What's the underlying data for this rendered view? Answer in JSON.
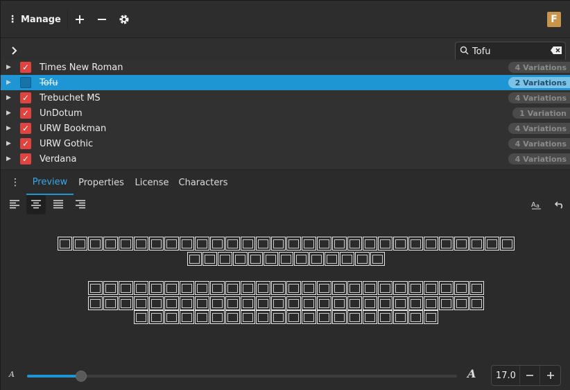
{
  "header": {
    "manage_label": "Manage",
    "font_badge": "F"
  },
  "search": {
    "value": "Tofu"
  },
  "fonts": [
    {
      "name": "Times New Roman",
      "variations": "4 Variations",
      "checked": true,
      "selected": false
    },
    {
      "name": "Tofu",
      "variations": "2 Variations",
      "checked": false,
      "selected": true
    },
    {
      "name": "Trebuchet MS",
      "variations": "4 Variations",
      "checked": true,
      "selected": false
    },
    {
      "name": "UnDotum",
      "variations": "1 Variation",
      "checked": true,
      "selected": false
    },
    {
      "name": "URW Bookman",
      "variations": "4 Variations",
      "checked": true,
      "selected": false
    },
    {
      "name": "URW Gothic",
      "variations": "4 Variations",
      "checked": true,
      "selected": false
    },
    {
      "name": "Verdana",
      "variations": "4 Variations",
      "checked": true,
      "selected": false
    }
  ],
  "tabs": [
    {
      "label": "Preview",
      "active": true
    },
    {
      "label": "Properties",
      "active": false
    },
    {
      "label": "License",
      "active": false
    },
    {
      "label": "Characters",
      "active": false
    }
  ],
  "preview": {
    "line_glyph_counts": [
      30,
      13,
      0,
      26,
      26,
      20
    ]
  },
  "size": {
    "value": "17.0",
    "slider_fraction": 0.125
  },
  "colors": {
    "accent": "#1e96d4",
    "checkbox": "#e2433e",
    "badge": "#c8954a"
  }
}
